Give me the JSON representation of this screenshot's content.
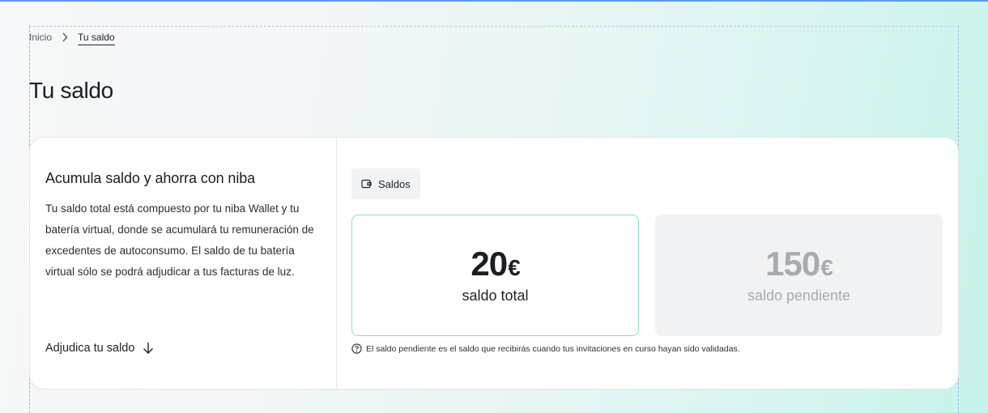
{
  "breadcrumb": {
    "home": "Inicio",
    "current": "Tu saldo"
  },
  "page": {
    "title": "Tu saldo"
  },
  "info": {
    "heading": "Acumula saldo y ahorra con niba",
    "description": "Tu saldo total está compuesto por tu niba Wallet y tu batería virtual, donde se acumulará tu remuneración de excedentes de autoconsumo. El saldo de tu batería virtual sólo se podrá adjudicar a tus facturas de luz.",
    "action_label": "Adjudica tu saldo",
    "action_icon": "arrow-down-icon"
  },
  "balances": {
    "chip_label": "Saldos",
    "chip_icon": "wallet-icon",
    "total": {
      "amount": "20",
      "currency": "€",
      "label": "saldo total"
    },
    "pending": {
      "amount": "150",
      "currency": "€",
      "label": "saldo pendiente"
    },
    "note": "El saldo pendiente es el saldo que recibirás cuando tus invitaciones en curso hayan sido validadas.",
    "note_icon": "question-circle-icon"
  },
  "colors": {
    "accent_border": "#8fe0c7",
    "pending_bg": "#f1f2f3",
    "pending_text": "#a7abaf"
  }
}
